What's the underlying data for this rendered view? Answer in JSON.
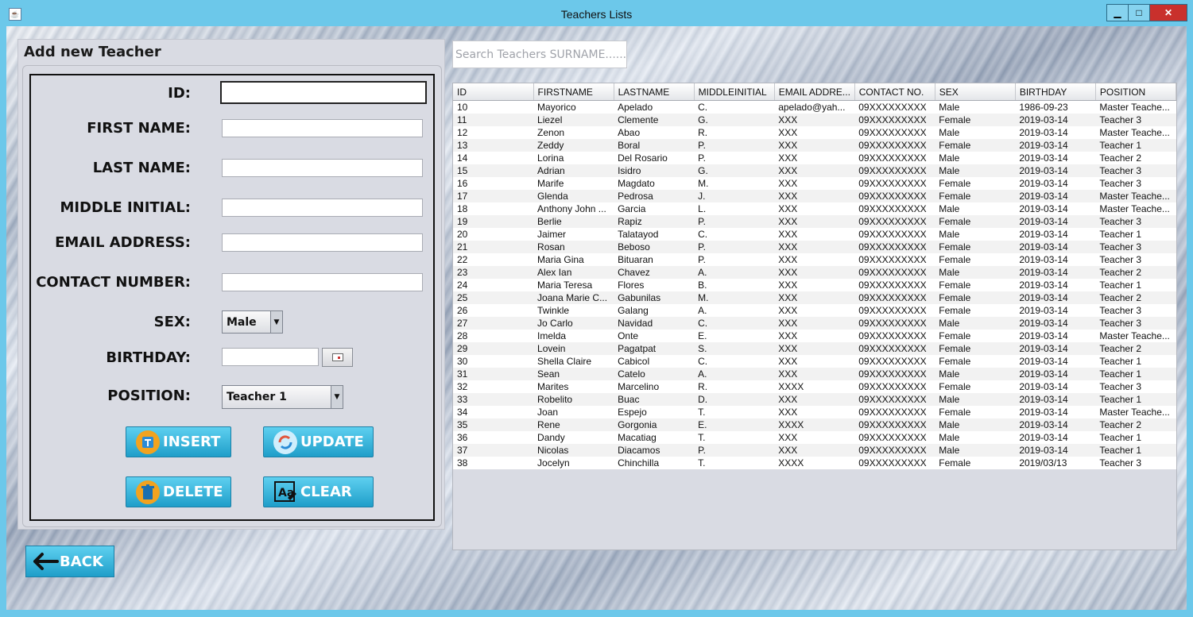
{
  "window": {
    "title": "Teachers Lists",
    "controls": {
      "minimize": "▁",
      "maximize": "□",
      "close": "✕"
    }
  },
  "form": {
    "panel_title": "Add new Teacher",
    "labels": {
      "id": "ID:",
      "first_name": "FIRST NAME:",
      "last_name": "LAST NAME:",
      "middle_initial": "MIDDLE INITIAL:",
      "email": "EMAIL ADDRESS:",
      "contact": "CONTACT NUMBER:",
      "sex": "SEX:",
      "birthday": "BIRTHDAY:",
      "position": "POSITION:"
    },
    "values": {
      "id": "",
      "first_name": "",
      "last_name": "",
      "middle_initial": "",
      "email": "",
      "contact": "",
      "birthday": ""
    },
    "sex_selected": "Male",
    "position_selected": "Teacher 1",
    "buttons": {
      "insert": "INSERT",
      "update": "UPDATE",
      "delete": "DELETE",
      "clear": "CLEAR"
    },
    "back": "BACK"
  },
  "search": {
    "placeholder": "Search Teachers SURNAME......"
  },
  "table": {
    "columns": [
      "ID",
      "FIRSTNAME",
      "LASTNAME",
      "MIDDLEINITIAL",
      "EMAIL ADDRE...",
      "CONTACT NO.",
      "SEX",
      "BIRTHDAY",
      "POSITION"
    ],
    "rows": [
      [
        "10",
        "Mayorico",
        "Apelado",
        "C.",
        "apelado@yah...",
        "09XXXXXXXXX",
        "Male",
        "1986-09-23",
        "Master Teache..."
      ],
      [
        "11",
        "Liezel",
        "Clemente",
        "G.",
        "XXX",
        "09XXXXXXXXX",
        "Female",
        "2019-03-14",
        "Teacher 3"
      ],
      [
        "12",
        "Zenon",
        "Abao",
        "R.",
        "XXX",
        "09XXXXXXXXX",
        "Male",
        "2019-03-14",
        "Master Teache..."
      ],
      [
        "13",
        "Zeddy",
        "Boral",
        "P.",
        "XXX",
        "09XXXXXXXXX",
        "Female",
        "2019-03-14",
        "Teacher 1"
      ],
      [
        "14",
        "Lorina",
        "Del Rosario",
        "P.",
        "XXX",
        "09XXXXXXXXX",
        "Male",
        "2019-03-14",
        "Teacher 2"
      ],
      [
        "15",
        "Adrian",
        "Isidro",
        "G.",
        "XXX",
        "09XXXXXXXXX",
        "Male",
        "2019-03-14",
        "Teacher 3"
      ],
      [
        "16",
        "Marife",
        "Magdato",
        "M.",
        "XXX",
        "09XXXXXXXXX",
        "Female",
        "2019-03-14",
        "Teacher 3"
      ],
      [
        "17",
        "Glenda",
        "Pedrosa",
        "J.",
        "XXX",
        "09XXXXXXXXX",
        "Female",
        "2019-03-14",
        "Master Teache..."
      ],
      [
        "18",
        "Anthony John ...",
        "Garcia",
        "L.",
        "XXX",
        "09XXXXXXXXX",
        "Male",
        "2019-03-14",
        "Master Teache..."
      ],
      [
        "19",
        "Berlie",
        "Rapiz",
        "P.",
        "XXX",
        "09XXXXXXXXX",
        "Female",
        "2019-03-14",
        "Teacher 3"
      ],
      [
        "20",
        "Jaimer",
        "Talatayod",
        "C.",
        "XXX",
        "09XXXXXXXXX",
        "Male",
        "2019-03-14",
        "Teacher 1"
      ],
      [
        "21",
        "Rosan",
        "Beboso",
        "P.",
        "XXX",
        "09XXXXXXXXX",
        "Female",
        "2019-03-14",
        "Teacher 3"
      ],
      [
        "22",
        "Maria Gina",
        "Bituaran",
        "P.",
        "XXX",
        "09XXXXXXXXX",
        "Female",
        "2019-03-14",
        "Teacher 3"
      ],
      [
        "23",
        "Alex Ian",
        "Chavez",
        "A.",
        "XXX",
        "09XXXXXXXXX",
        "Male",
        "2019-03-14",
        "Teacher 2"
      ],
      [
        "24",
        "Maria Teresa",
        "Flores",
        "B.",
        "XXX",
        "09XXXXXXXXX",
        "Female",
        "2019-03-14",
        "Teacher 1"
      ],
      [
        "25",
        "Joana Marie C...",
        "Gabunilas",
        "M.",
        "XXX",
        "09XXXXXXXXX",
        "Female",
        "2019-03-14",
        "Teacher 2"
      ],
      [
        "26",
        "Twinkle",
        "Galang",
        "A.",
        "XXX",
        "09XXXXXXXXX",
        "Female",
        "2019-03-14",
        "Teacher 3"
      ],
      [
        "27",
        "Jo Carlo",
        "Navidad",
        "C.",
        "XXX",
        "09XXXXXXXXX",
        "Male",
        "2019-03-14",
        "Teacher 3"
      ],
      [
        "28",
        "Imelda",
        "Onte",
        "E.",
        "XXX",
        "09XXXXXXXXX",
        "Female",
        "2019-03-14",
        "Master Teache..."
      ],
      [
        "29",
        "Lovein",
        "Pagatpat",
        "S.",
        "XXX",
        "09XXXXXXXXX",
        "Female",
        "2019-03-14",
        "Teacher 2"
      ],
      [
        "30",
        "Shella Claire",
        "Cabicol",
        "C.",
        "XXX",
        "09XXXXXXXXX",
        "Female",
        "2019-03-14",
        "Teacher 1"
      ],
      [
        "31",
        "Sean",
        "Catelo",
        "A.",
        "XXX",
        "09XXXXXXXXX",
        "Male",
        "2019-03-14",
        "Teacher 1"
      ],
      [
        "32",
        "Marites",
        "Marcelino",
        "R.",
        "XXXX",
        "09XXXXXXXXX",
        "Female",
        "2019-03-14",
        "Teacher 3"
      ],
      [
        "33",
        "Robelito",
        "Buac",
        "D.",
        "XXX",
        "09XXXXXXXXX",
        "Male",
        "2019-03-14",
        "Teacher 1"
      ],
      [
        "34",
        "Joan",
        "Espejo",
        "T.",
        "XXX",
        "09XXXXXXXXX",
        "Female",
        "2019-03-14",
        "Master Teache..."
      ],
      [
        "35",
        "Rene",
        "Gorgonia",
        "E.",
        "XXXX",
        "09XXXXXXXXX",
        "Male",
        "2019-03-14",
        "Teacher 2"
      ],
      [
        "36",
        "Dandy",
        "Macatiag",
        "T.",
        "XXX",
        "09XXXXXXXXX",
        "Male",
        "2019-03-14",
        "Teacher 1"
      ],
      [
        "37",
        "Nicolas",
        "Diacamos",
        "P.",
        "XXX",
        "09XXXXXXXXX",
        "Male",
        "2019-03-14",
        "Teacher 1"
      ],
      [
        "38",
        "Jocelyn",
        "Chinchilla",
        "T.",
        "XXXX",
        "09XXXXXXXXX",
        "Female",
        "2019/03/13",
        "Teacher 3"
      ]
    ]
  },
  "colors": {
    "accent": "#6cc8ea",
    "button": "#1f9ec9",
    "close": "#c9302c"
  },
  "icons": {
    "app": "java-icon",
    "insert": "insert-icon",
    "update": "refresh-icon",
    "delete": "trash-icon",
    "clear": "clear-icon",
    "back": "arrow-left-icon",
    "calendar": "calendar-icon"
  }
}
